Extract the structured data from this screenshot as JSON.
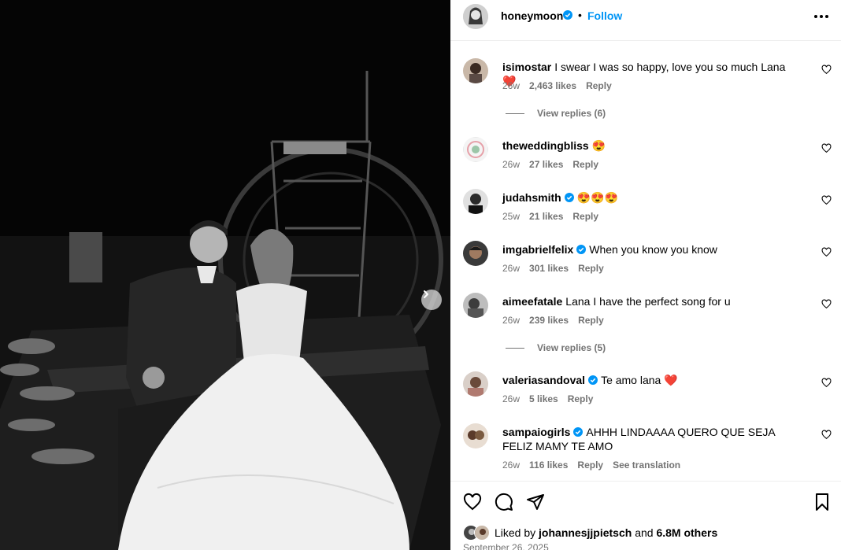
{
  "post": {
    "username": "honeymoon",
    "follow_label": "Follow",
    "dot": "•"
  },
  "comments": [
    {
      "username": "isimostar",
      "text": "I swear I was so happy, love you so much Lana ❤️",
      "age": "26w",
      "likes": "2,463 likes",
      "reply": "Reply",
      "verified": false,
      "view_replies": "View replies (6)"
    },
    {
      "username": "theweddingbliss",
      "text": "😍",
      "age": "26w",
      "likes": "27 likes",
      "reply": "Reply",
      "verified": false
    },
    {
      "username": "judahsmith",
      "text": "😍😍😍",
      "age": "25w",
      "likes": "21 likes",
      "reply": "Reply",
      "verified": true
    },
    {
      "username": "imgabrielfelix",
      "text": "When you know you know",
      "age": "26w",
      "likes": "301 likes",
      "reply": "Reply",
      "verified": true
    },
    {
      "username": "aimeefatale",
      "text": "Lana I have the perfect song for u",
      "age": "26w",
      "likes": "239 likes",
      "reply": "Reply",
      "verified": false,
      "view_replies": "View replies (5)"
    },
    {
      "username": "valeriasandoval",
      "text": "Te amo lana ❤️",
      "age": "26w",
      "likes": "5 likes",
      "reply": "Reply",
      "verified": true
    },
    {
      "username": "sampaiogirls",
      "text": "AHHH LINDAAAA QUERO QUE SEJA FELIZ MAMY TE AMO",
      "age": "26w",
      "likes": "116 likes",
      "reply": "Reply",
      "see_translation": "See translation",
      "verified": true
    }
  ],
  "likes": {
    "prefix": "Liked by",
    "user": "johannesjjpietsch",
    "and": "and",
    "others": "6.8M others"
  },
  "date": "September 26, 2025",
  "icons": [
    "more-options-icon",
    "heart-icon",
    "comment-icon",
    "share-icon",
    "bookmark-icon",
    "chevron-right-icon",
    "verified-icon"
  ],
  "colors": {
    "link": "#0095f6",
    "verified": "#0095f6",
    "meta": "#737373",
    "border": "#efefef"
  }
}
